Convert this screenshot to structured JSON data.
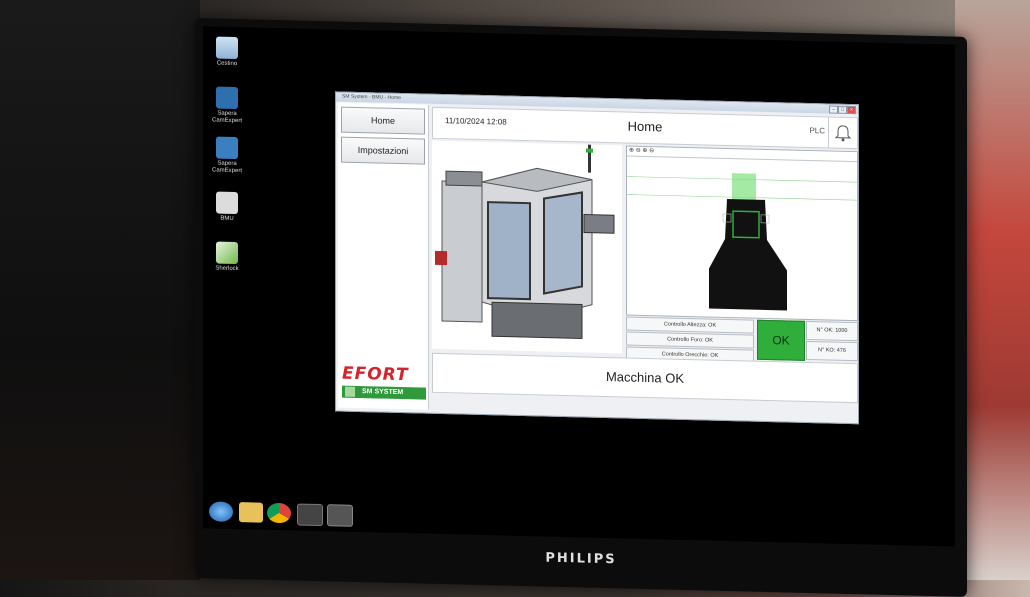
{
  "window": {
    "title": "SM System - BMU - Home"
  },
  "desktop_icons": [
    {
      "label": "Cestino",
      "icon": "recycle-bin-icon"
    },
    {
      "label": "Sapera CamExpert",
      "icon": "camexpert-icon"
    },
    {
      "label": "Sapera CamExpert",
      "icon": "camexpert-icon"
    },
    {
      "label": "BMU",
      "icon": "bmu-app-icon"
    },
    {
      "label": "Sherlock",
      "icon": "sherlock-icon"
    }
  ],
  "sidebar": {
    "items": [
      {
        "label": "Home"
      },
      {
        "label": "Impostazioni"
      }
    ]
  },
  "logo": {
    "brand": "EFORT",
    "sub": "SM SYSTEM",
    "brand_color": "#d4232a",
    "sub_color": "#2e9a3b"
  },
  "header": {
    "datetime": "11/10/2024 12:08",
    "title": "Home",
    "plc": "PLC"
  },
  "checks": [
    {
      "label": "Controllo Altezza: OK"
    },
    {
      "label": "Controllo Foro: OK"
    },
    {
      "label": "Controllo Orecchie: OK"
    }
  ],
  "result": {
    "label": "OK",
    "color": "#2fae3b"
  },
  "counters": {
    "ok": "N° OK: 1000",
    "ko": "N° KO: 476"
  },
  "status": {
    "message": "Macchina OK"
  },
  "monitor": {
    "brand": "PHILIPS"
  }
}
